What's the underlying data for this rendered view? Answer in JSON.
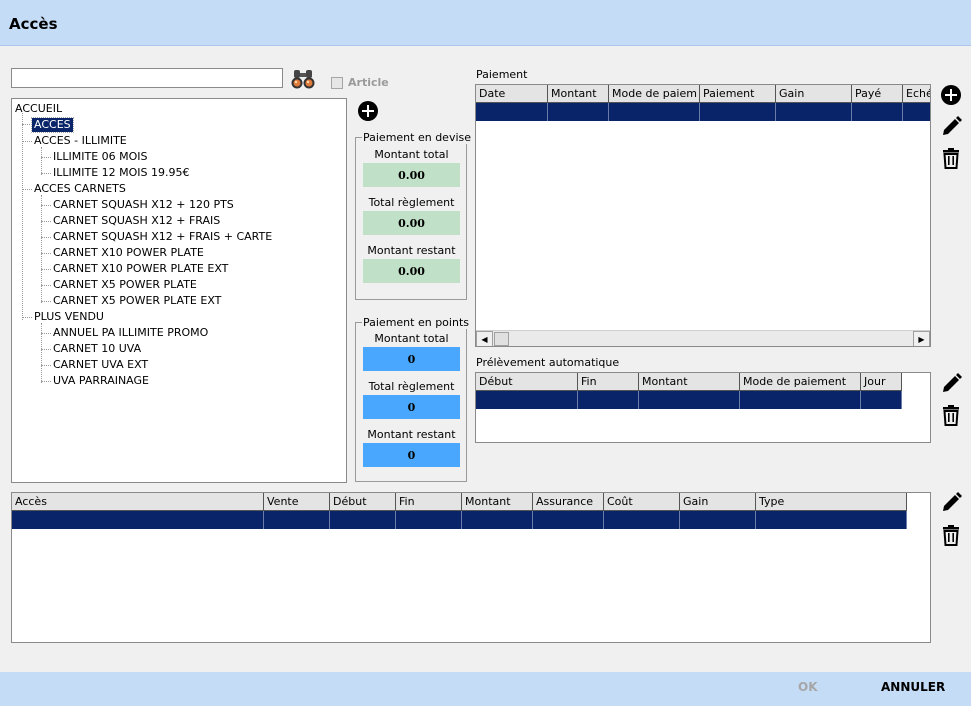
{
  "window": {
    "title": "Accès"
  },
  "search": {
    "value": "",
    "placeholder": ""
  },
  "article_checkbox": {
    "label": "Article",
    "checked": false
  },
  "tree": {
    "root": "ACCUEIL",
    "items": [
      {
        "label": "ACCES",
        "selected": true
      },
      {
        "label": "ACCES - ILLIMITE"
      },
      {
        "label": "ILLIMITE 06 MOIS"
      },
      {
        "label": "ILLIMITE 12 MOIS 19.95€"
      },
      {
        "label": "ACCES CARNETS"
      },
      {
        "label": "CARNET SQUASH  X12 + 120 PTS"
      },
      {
        "label": "CARNET SQUASH  X12 + FRAIS"
      },
      {
        "label": "CARNET SQUASH  X12 + FRAIS + CARTE"
      },
      {
        "label": "CARNET X10 POWER PLATE"
      },
      {
        "label": "CARNET X10 POWER PLATE EXT"
      },
      {
        "label": "CARNET X5 POWER PLATE"
      },
      {
        "label": "CARNET X5 POWER PLATE EXT"
      },
      {
        "label": "PLUS VENDU"
      },
      {
        "label": "ANNUEL PA ILLIMITE PROMO"
      },
      {
        "label": "CARNET 10 UVA"
      },
      {
        "label": "CARNET UVA EXT"
      },
      {
        "label": "UVA PARRAINAGE"
      }
    ]
  },
  "devise": {
    "title": "Paiement en devise",
    "montant_total_label": "Montant total",
    "montant_total": "0.00",
    "total_reglement_label": "Total règlement",
    "total_reglement": "0.00",
    "montant_restant_label": "Montant restant",
    "montant_restant": "0.00"
  },
  "points": {
    "title": "Paiement en points",
    "montant_total_label": "Montant total",
    "montant_total": "0",
    "total_reglement_label": "Total règlement",
    "total_reglement": "0",
    "montant_restant_label": "Montant restant",
    "montant_restant": "0"
  },
  "paiement": {
    "label": "Paiement",
    "columns": [
      "Date",
      "Montant",
      "Mode de paiem",
      "Paiement",
      "Gain",
      "Payé",
      "Echéa"
    ]
  },
  "prelevement": {
    "label": "Prélèvement automatique",
    "columns": [
      "Début",
      "Fin",
      "Montant",
      "Mode de paiement",
      "Jour"
    ]
  },
  "acces_grid": {
    "columns": [
      "Accès",
      "Vente",
      "Début",
      "Fin",
      "Montant",
      "Assurance",
      "Coût",
      "Gain",
      "Type"
    ]
  },
  "footer": {
    "ok": "OK",
    "cancel": "ANNULER"
  }
}
